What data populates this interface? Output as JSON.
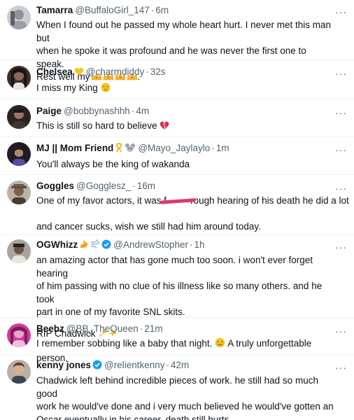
{
  "tweets": [
    {
      "name": "Tamarra",
      "handle": "@BuffaloGirl_147",
      "time": "6m",
      "text": "When I found out he passed my whole heart hurt. I never met this man but\nwhen he spoke it was profound and he was never the first one to speak.\nRest well my",
      "trailing": "."
    },
    {
      "name": "Chelsea",
      "handle": "@charmdiddy",
      "time": "32s",
      "text": "I miss my King"
    },
    {
      "name": "Paige",
      "handle": "@bobbynashhh",
      "time": "4m",
      "text": "This is still so hard to believe"
    },
    {
      "name": "MJ || Mom Friend",
      "handle": "@Mayo_Jaylaylo",
      "time": "1m",
      "text": "You'll always be the king of wakanda"
    },
    {
      "name": "Goggles",
      "handle": "@Gogglesz_",
      "time": "16m",
      "text_a": "One of my favor actors, it was f",
      "text_b": "rough hearing of his death he did a lot",
      "text_c": "and cancer sucks, wish we still had him around today."
    },
    {
      "name": "OGWhizz",
      "handle": "@AndrewStopher",
      "time": "1h",
      "text": "an amazing actor that has gone much too soon. i won't ever forget hearing\nof him passing with no clue of his illness like so many others. and he took\npart in one of my favorite SNL skits.",
      "text_2": "RIP Chadwick"
    },
    {
      "name": "Beebz",
      "handle": "@BB_TheQueen",
      "time": "21m",
      "text": "I remember sobbing like a baby that night.",
      "text_after": "A truly unforgettable person."
    },
    {
      "name": "kenny jones",
      "handle": "@relientkenny",
      "time": "42m",
      "text": "Chadwick left behind incredible pieces of work. he still had so much good\nwork he would've done and i very much believed he would've gotten an\nOscar eventually in his career. death still hurts"
    }
  ],
  "ui": {
    "separator": "·",
    "more": "···"
  },
  "colors": {
    "text": "#0f1419",
    "secondary": "#536471",
    "verified": "#1d9bf0",
    "divider": "#eff3f4",
    "redaction": "#e0386a"
  },
  "icons": {
    "more": "more-horizontal-icon",
    "verified": "verified-badge-icon"
  }
}
